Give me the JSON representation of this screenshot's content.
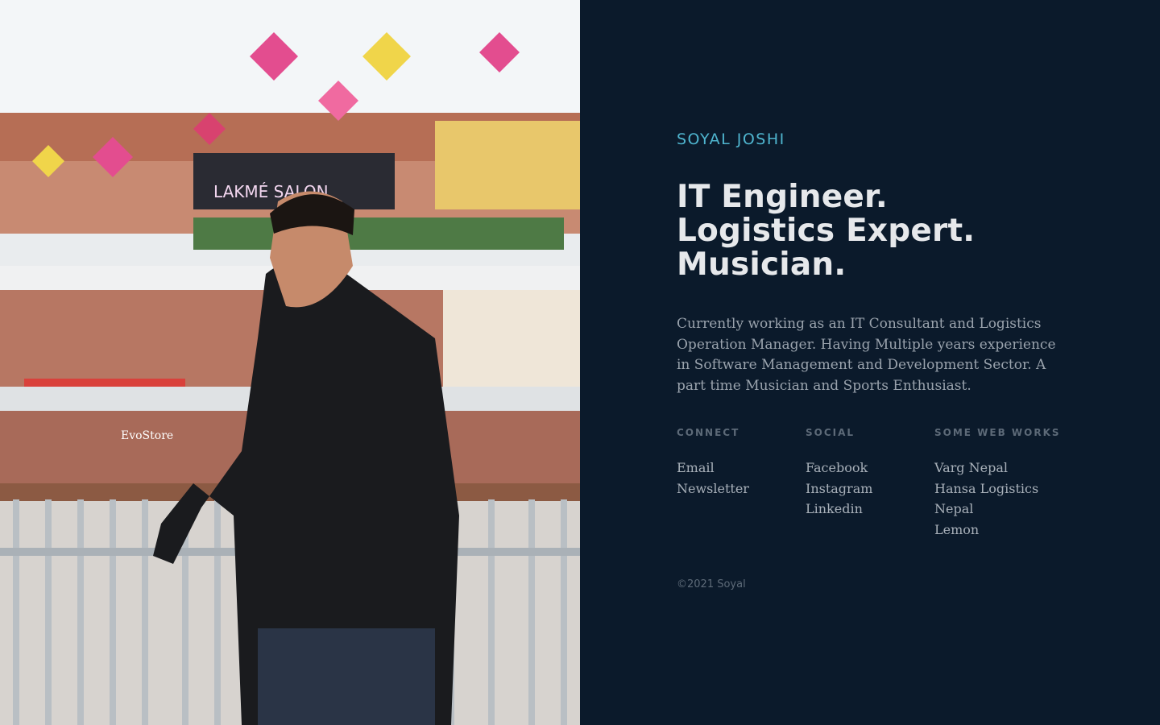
{
  "photo": {
    "alt": "Portrait of Soyal Joshi in a shopping mall",
    "sign_text_1": "LAKMÉ SALON",
    "sign_text_2": "EvoStore"
  },
  "profile": {
    "name": "SOYAL JOSHI",
    "headline": [
      "IT Engineer.",
      "Logistics Expert.",
      "Musician."
    ],
    "bio": "Currently working as an IT Consultant and Logistics Operation Manager. Having Multiple years experience in Software Management and Development Sector. A part time Musician and Sports Enthusiast."
  },
  "columns": [
    {
      "title": "CONNECT",
      "items": [
        "Email",
        "Newsletter"
      ]
    },
    {
      "title": "SOCIAL",
      "items": [
        "Facebook",
        "Instagram",
        "Linkedin"
      ]
    },
    {
      "title": "SOME WEB WORKS",
      "items": [
        "Varg Nepal",
        "Hansa Logistics",
        "Nepal",
        "Lemon"
      ]
    }
  ],
  "footer": {
    "copyright": "©2021 Soyal"
  },
  "colors": {
    "background": "#0b1a2b",
    "accent": "#4fb5cf",
    "headline": "#e6e8eb",
    "body_text": "#9aa3ad",
    "muted": "#5d6a78"
  }
}
